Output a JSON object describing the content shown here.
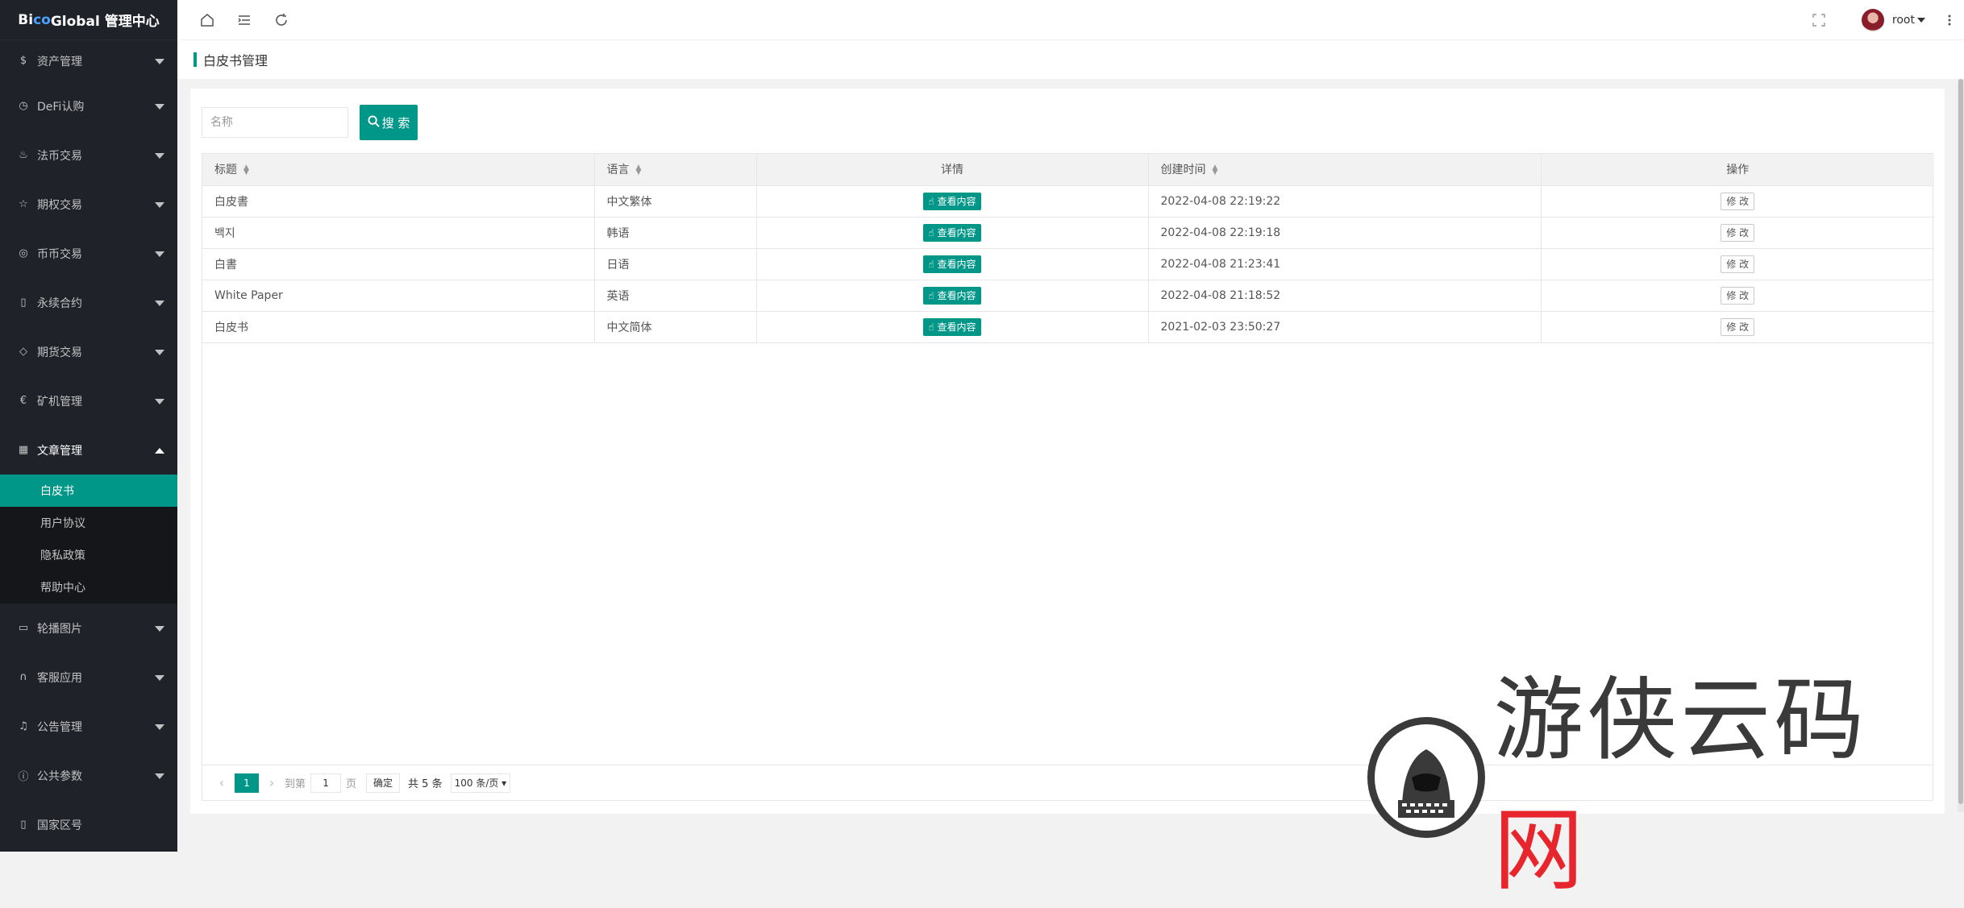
{
  "app": {
    "title_prefix": "Bi",
    "title_accent": "co",
    "title_rest": " Global 管理中心"
  },
  "sidebar": {
    "items": [
      {
        "label": "资产管理",
        "icon": "dollar-icon"
      },
      {
        "label": "DeFi认购",
        "icon": "clock-icon"
      },
      {
        "label": "法币交易",
        "icon": "fire-icon"
      },
      {
        "label": "期权交易",
        "icon": "star-icon"
      },
      {
        "label": "币币交易",
        "icon": "coin-icon"
      },
      {
        "label": "永续合约",
        "icon": "file-icon"
      },
      {
        "label": "期货交易",
        "icon": "diamond-icon"
      },
      {
        "label": "矿机管理",
        "icon": "euro-icon"
      },
      {
        "label": "文章管理",
        "icon": "book-icon"
      }
    ],
    "sub_items": [
      {
        "label": "白皮书",
        "active": true
      },
      {
        "label": "用户协议"
      },
      {
        "label": "隐私政策"
      },
      {
        "label": "帮助中心"
      }
    ],
    "items_after": [
      {
        "label": "轮播图片",
        "icon": "image-icon"
      },
      {
        "label": "客服应用",
        "icon": "headset-icon"
      },
      {
        "label": "公告管理",
        "icon": "bell-icon"
      },
      {
        "label": "公共参数",
        "icon": "info-icon"
      },
      {
        "label": "国家区号",
        "icon": "phone-icon"
      }
    ]
  },
  "topbar": {
    "user": "root"
  },
  "breadcrumb": {
    "title": "白皮书管理"
  },
  "search": {
    "placeholder": "名称",
    "button_label": "搜 索"
  },
  "table": {
    "headers": [
      "标题",
      "语言",
      "详情",
      "创建时间",
      "操作"
    ],
    "rows": [
      {
        "title": "白皮書",
        "lang": "中文繁体",
        "detail": "查看内容",
        "created": "2022-04-08 22:19:22",
        "action": "修 改"
      },
      {
        "title": "백지",
        "lang": "韩语",
        "detail": "查看内容",
        "created": "2022-04-08 22:19:18",
        "action": "修 改"
      },
      {
        "title": "白書",
        "lang": "日语",
        "detail": "查看内容",
        "created": "2022-04-08 21:23:41",
        "action": "修 改"
      },
      {
        "title": "White Paper",
        "lang": "英语",
        "detail": "查看内容",
        "created": "2022-04-08 21:18:52",
        "action": "修 改"
      },
      {
        "title": "白皮书",
        "lang": "中文简体",
        "detail": "查看内容",
        "created": "2021-02-03 23:50:27",
        "action": "修 改"
      }
    ]
  },
  "pager": {
    "current": "1",
    "goto_label": "到第",
    "goto_value": "1",
    "page_unit": "页",
    "confirm": "确定",
    "total": "共 5 条",
    "per_page": "100 条/页"
  },
  "watermark": {
    "text": "游侠云码",
    "red": "网"
  },
  "colors": {
    "accent": "#009688",
    "sidebar_bg": "#20222a"
  }
}
